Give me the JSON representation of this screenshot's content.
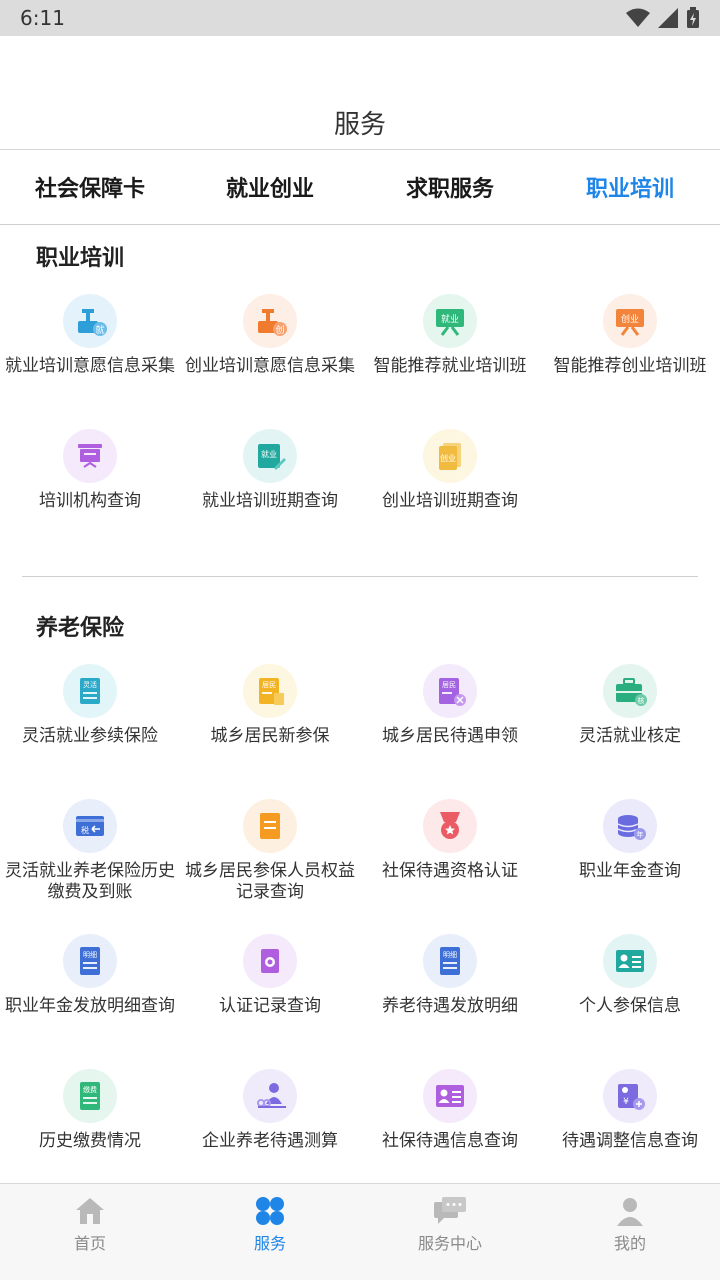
{
  "status": {
    "time": "6:11"
  },
  "header": {
    "title": "服务"
  },
  "tabs": [
    {
      "label": "社会保障卡"
    },
    {
      "label": "就业创业"
    },
    {
      "label": "求职服务"
    },
    {
      "label": "职业培训",
      "active": true
    }
  ],
  "sections": [
    {
      "title": "职业培训",
      "items": [
        {
          "label": "就业培训意愿信息采集",
          "icon": "training-intent-icon",
          "badge": "就"
        },
        {
          "label": "创业培训意愿信息采集",
          "icon": "startup-intent-icon",
          "badge": "创"
        },
        {
          "label": "智能推荐就业培训班",
          "icon": "employment-board-icon",
          "badge": "就业"
        },
        {
          "label": "智能推荐创业培训班",
          "icon": "startup-board-icon",
          "badge": "创业"
        },
        {
          "label": "培训机构查询",
          "icon": "institution-icon"
        },
        {
          "label": "就业培训班期查询",
          "icon": "employment-class-icon",
          "badge": "就业"
        },
        {
          "label": "创业培训班期查询",
          "icon": "startup-class-icon",
          "badge": "创业"
        }
      ]
    },
    {
      "title": "养老保险",
      "items": [
        {
          "label": "灵活就业参续保险",
          "icon": "flexible-insure-icon",
          "badge": "灵活"
        },
        {
          "label": "城乡居民新参保",
          "icon": "resident-new-icon",
          "badge": "居民"
        },
        {
          "label": "城乡居民待遇申领",
          "icon": "resident-claim-icon",
          "badge": "居民"
        },
        {
          "label": "灵活就业核定",
          "icon": "briefcase-verify-icon",
          "badge": "核"
        },
        {
          "label": "灵活就业养老保险历史缴费及到账",
          "icon": "tax-history-icon",
          "badge": "税"
        },
        {
          "label": "城乡居民参保人员权益记录查询",
          "icon": "rights-record-icon"
        },
        {
          "label": "社保待遇资格认证",
          "icon": "qualification-medal-icon"
        },
        {
          "label": "职业年金查询",
          "icon": "annuity-coins-icon",
          "badge": "年"
        },
        {
          "label": "职业年金发放明细查询",
          "icon": "annuity-detail-icon",
          "badge": "明细"
        },
        {
          "label": "认证记录查询",
          "icon": "auth-record-icon"
        },
        {
          "label": "养老待遇发放明细",
          "icon": "pension-detail-icon",
          "badge": "明细"
        },
        {
          "label": "个人参保信息",
          "icon": "id-card-icon"
        },
        {
          "label": "历史缴费情况",
          "icon": "payment-history-icon",
          "badge": "缴费"
        },
        {
          "label": "企业养老待遇测算",
          "icon": "pension-calc-icon"
        },
        {
          "label": "社保待遇信息查询",
          "icon": "benefit-info-icon"
        },
        {
          "label": "待遇调整信息查询",
          "icon": "adjustment-info-icon",
          "badge": "¥"
        }
      ]
    }
  ],
  "bottom_nav": [
    {
      "label": "首页",
      "icon": "home-icon"
    },
    {
      "label": "服务",
      "icon": "service-grid-icon",
      "active": true
    },
    {
      "label": "服务中心",
      "icon": "chat-bubbles-icon"
    },
    {
      "label": "我的",
      "icon": "user-icon"
    }
  ],
  "colors": {
    "accent": "#1f86e8",
    "divider": "#cfcfcf",
    "tab_text": "#1a1a1a",
    "nav_inactive": "#8a8a8a"
  }
}
